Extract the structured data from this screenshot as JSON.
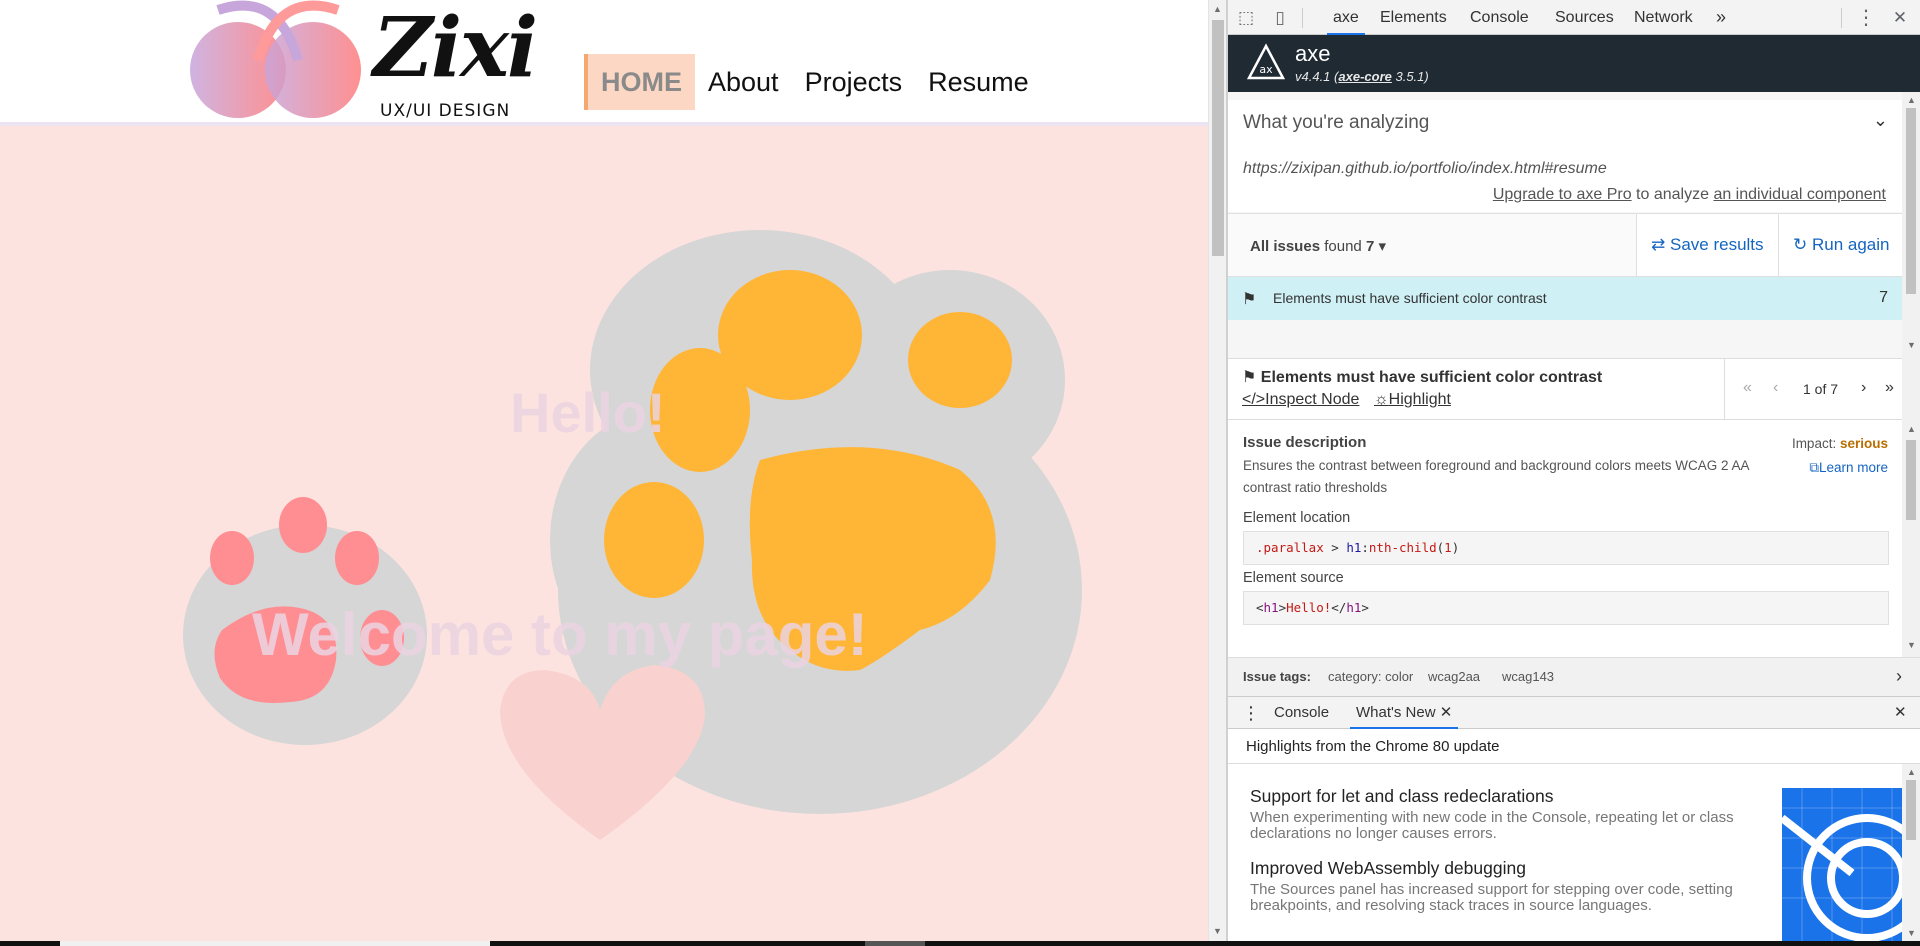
{
  "site": {
    "logo_text": "Zixi",
    "logo_sub": "UX/UI DESIGN",
    "nav": [
      {
        "label": "HOME"
      },
      {
        "label": "About"
      },
      {
        "label": "Projects"
      },
      {
        "label": "Resume"
      }
    ],
    "hero_hello": "Hello!",
    "hero_welcome": "Welcome to my page!"
  },
  "devtools": {
    "tabs": [
      "axe",
      "Elements",
      "Console",
      "Sources",
      "Network"
    ],
    "more_tabs": "»",
    "menu_glyph": "⋮",
    "close_glyph": "✕"
  },
  "axe": {
    "name": "axe",
    "version": "v4.4.1",
    "core_label": "axe-core",
    "core_version": "3.5.1",
    "analyzing_title": "What you're analyzing",
    "analyzing_url": "https://zixipan.github.io/portfolio/index.html#resume",
    "upgrade_link": "Upgrade to axe Pro",
    "upgrade_mid": "to analyze",
    "component_link": "an individual component",
    "all_issues_label": "All issues",
    "found_label": "found",
    "found_count": "7",
    "save_results": "Save results",
    "run_again": "Run again",
    "issue_row_text": "Elements must have sufficient color contrast",
    "issue_row_count": "7",
    "detail_title": "Elements must have sufficient color contrast",
    "inspect_node": "Inspect Node",
    "highlight": "Highlight",
    "pager_text": "1 of 7",
    "issue_desc_title": "Issue description",
    "issue_desc_text": "Ensures the contrast between foreground and background colors meets WCAG 2 AA contrast ratio thresholds",
    "impact_label": "Impact:",
    "impact_value": "serious",
    "learn_more": "Learn more",
    "element_location_label": "Element location",
    "element_location_parts": [
      ".parallax",
      " > ",
      "h1",
      ":",
      "nth-child",
      "(",
      "1",
      ")"
    ],
    "element_source_label": "Element source",
    "element_source_parts": [
      "<",
      "h1",
      ">",
      "Hello!",
      "</",
      "h1",
      ">"
    ],
    "tags_label": "Issue tags:",
    "tags": [
      "category: color",
      "wcag2aa",
      "wcag143"
    ]
  },
  "drawer": {
    "tabs": [
      "Console",
      "What's New"
    ],
    "highlights": "Highlights from the Chrome 80 update",
    "items": [
      {
        "title": "Support for let and class redeclarations",
        "body": "When experimenting with new code in the Console, repeating let or class declarations no longer causes errors."
      },
      {
        "title": "Improved WebAssembly debugging",
        "body": "The Sources panel has increased support for stepping over code, setting breakpoints, and resolving stack traces in source languages."
      }
    ]
  },
  "colors": {
    "site_bg": "#fde3df",
    "axe_header": "#1f2a33",
    "issue_row": "#cff0f4",
    "accent": "#1565c0",
    "impact_serious": "#b86e00"
  }
}
